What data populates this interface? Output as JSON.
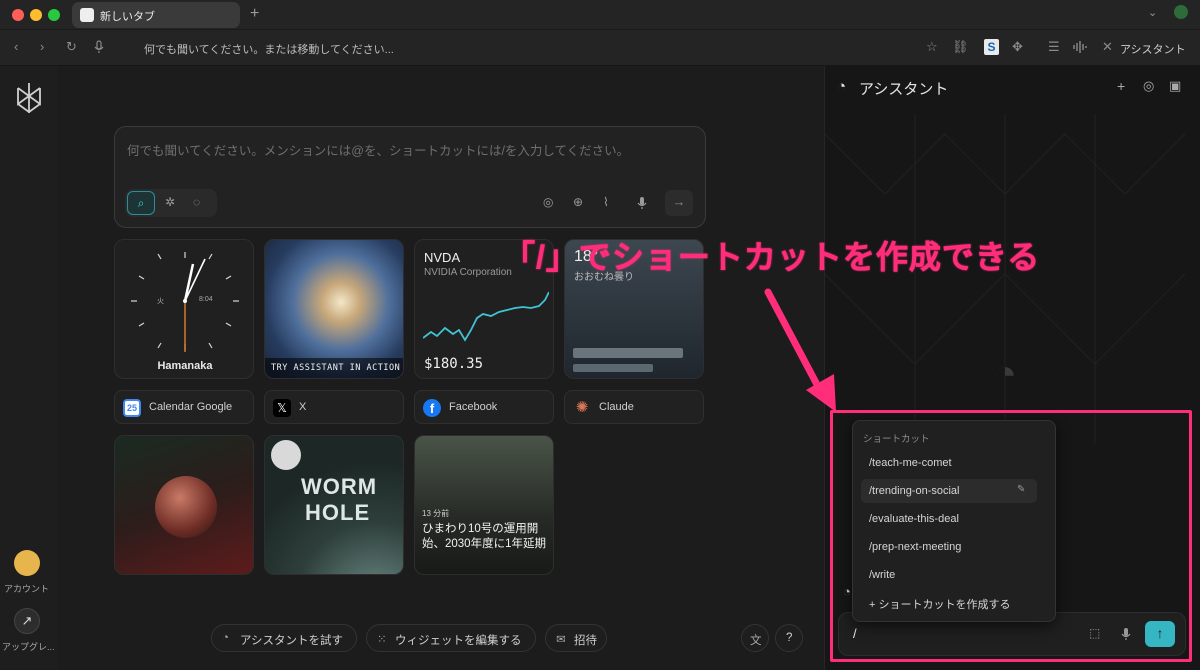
{
  "browser": {
    "tab_title": "新しいタブ",
    "new_tab_symbol": "+",
    "omnibox_placeholder": "何でも聞いてください。または移動してください...",
    "assistant_button": "アシスタント",
    "extension_badge": "S"
  },
  "sidebar": {
    "account_label": "アカウント",
    "upgrade_label": "アップグレ..."
  },
  "search": {
    "placeholder": "何でも聞いてください。メンションには@を、ショートカットには/を入力してください。"
  },
  "widgets": {
    "clock": {
      "label": "Hamanaka",
      "day": "火",
      "time": "8:04"
    },
    "assistant_card": {
      "caption": "TRY ASSISTANT IN ACTION"
    },
    "stock": {
      "ticker": "NVDA",
      "company": "NVIDIA Corporation",
      "price": "$180.35"
    },
    "weather": {
      "temp": "18°",
      "desc": "おおむね曇り"
    },
    "news": {
      "time": "13 分前",
      "headline": "ひまわり10号の運用開始、2030年度に1年延期"
    },
    "worm_hole": {
      "title_line1": "WORM",
      "title_line2": "HOLE"
    }
  },
  "quick_links": [
    {
      "label": "Calendar Google",
      "icon": "calendar-icon",
      "color": "#4285f4"
    },
    {
      "label": "X",
      "icon": "x-icon",
      "color": "#ffffff"
    },
    {
      "label": "Facebook",
      "icon": "facebook-icon",
      "color": "#1877f2"
    },
    {
      "label": "Claude",
      "icon": "claude-icon",
      "color": "#d97757"
    }
  ],
  "bottom_bar": {
    "try_assistant": "アシスタントを試す",
    "edit_widgets": "ウィジェットを編集する",
    "invite": "招待",
    "help": "?"
  },
  "assistant_panel": {
    "title": "アシスタント",
    "input_value": "/"
  },
  "shortcut_popup": {
    "header": "ショートカット",
    "items": [
      "/teach-me-comet",
      "/trending-on-social",
      "/evaluate-this-deal",
      "/prep-next-meeting",
      "/write"
    ],
    "create_label": "+ ショートカットを作成する"
  },
  "annotation": {
    "callout_text": "「/」でショートカットを作成できる",
    "accent_color": "#ff2d7a"
  }
}
